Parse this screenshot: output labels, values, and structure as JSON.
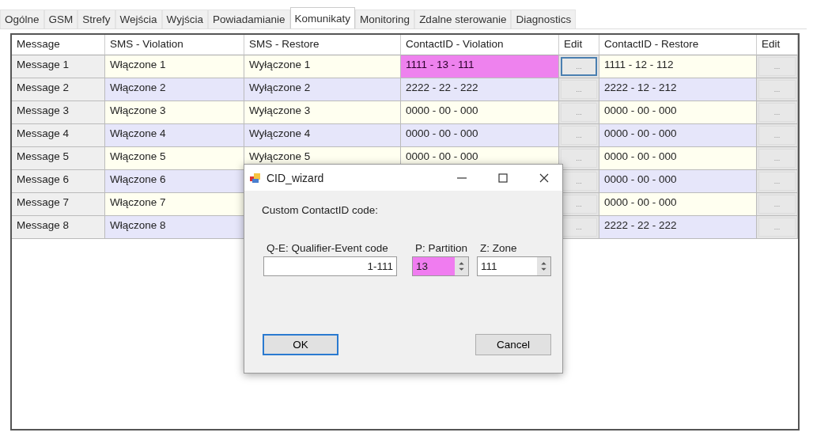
{
  "tabs": [
    {
      "label": "Ogólne",
      "selected": false
    },
    {
      "label": "GSM",
      "selected": false
    },
    {
      "label": "Strefy",
      "selected": false
    },
    {
      "label": "Wejścia",
      "selected": false
    },
    {
      "label": "Wyjścia",
      "selected": false
    },
    {
      "label": "Powiadamianie",
      "selected": false
    },
    {
      "label": "Komunikaty",
      "selected": true
    },
    {
      "label": "Monitoring",
      "selected": false
    },
    {
      "label": "Zdalne sterowanie",
      "selected": false
    },
    {
      "label": "Diagnostics",
      "selected": false
    }
  ],
  "table": {
    "columns": [
      "Message",
      "SMS - Violation",
      "SMS - Restore",
      "ContactID - Violation",
      "Edit",
      "ContactID - Restore",
      "Edit"
    ],
    "rows": [
      {
        "message": "Message 1",
        "sms_violation": "Włączone 1",
        "sms_restore": "Wyłączone 1",
        "cid_violation": "1111 - 13 - 111",
        "cid_violation_selected": true,
        "edit_violation": "...",
        "edit_violation_focused": true,
        "cid_restore": "1111 - 12 - 112",
        "edit_restore": "..."
      },
      {
        "message": "Message 2",
        "sms_violation": "Włączone 2",
        "sms_restore": "Wyłączone 2",
        "cid_violation": "2222 - 22 - 222",
        "cid_violation_selected": false,
        "edit_violation": "...",
        "edit_violation_focused": false,
        "cid_restore": "2222 - 12 - 212",
        "edit_restore": "..."
      },
      {
        "message": "Message 3",
        "sms_violation": "Włączone 3",
        "sms_restore": "Wyłączone 3",
        "cid_violation": "0000 - 00 - 000",
        "cid_violation_selected": false,
        "edit_violation": "...",
        "edit_violation_focused": false,
        "cid_restore": "0000 - 00 - 000",
        "edit_restore": "..."
      },
      {
        "message": "Message 4",
        "sms_violation": "Włączone 4",
        "sms_restore": "Wyłączone 4",
        "cid_violation": "0000 - 00 - 000",
        "cid_violation_selected": false,
        "edit_violation": "...",
        "edit_violation_focused": false,
        "cid_restore": "0000 - 00 - 000",
        "edit_restore": "..."
      },
      {
        "message": "Message 5",
        "sms_violation": "Włączone 5",
        "sms_restore": "Wyłączone 5",
        "cid_violation": "0000 - 00 - 000",
        "cid_violation_selected": false,
        "edit_violation": "...",
        "edit_violation_focused": false,
        "cid_restore": "0000 - 00 - 000",
        "edit_restore": "..."
      },
      {
        "message": "Message 6",
        "sms_violation": "Włączone 6",
        "edit_violation": "...",
        "edit_violation_focused": false,
        "cid_restore": "0000 - 00 - 000",
        "edit_restore": "..."
      },
      {
        "message": "Message 7",
        "sms_violation": "Włączone 7",
        "edit_violation": "...",
        "edit_violation_focused": false,
        "cid_restore": "0000 - 00 - 000",
        "edit_restore": "..."
      },
      {
        "message": "Message 8",
        "sms_violation": "Włączone 8",
        "edit_violation": "...",
        "edit_violation_focused": false,
        "cid_restore": "2222 - 22 - 222",
        "edit_restore": "..."
      }
    ]
  },
  "dialog": {
    "title": "CID_wizard",
    "prompt": "Custom ContactID code:",
    "fields": [
      {
        "kind": "text",
        "label": "Q-E: Qualifier-Event code",
        "value": "1-111",
        "highlighted": false
      },
      {
        "kind": "spinner",
        "label": "P: Partition",
        "value": "13",
        "highlighted": true
      },
      {
        "kind": "spinner",
        "label": "Z: Zone",
        "value": "111",
        "highlighted": false
      }
    ],
    "buttons": [
      {
        "label": "OK",
        "focused": true
      },
      {
        "label": "Cancel",
        "focused": false
      }
    ]
  }
}
